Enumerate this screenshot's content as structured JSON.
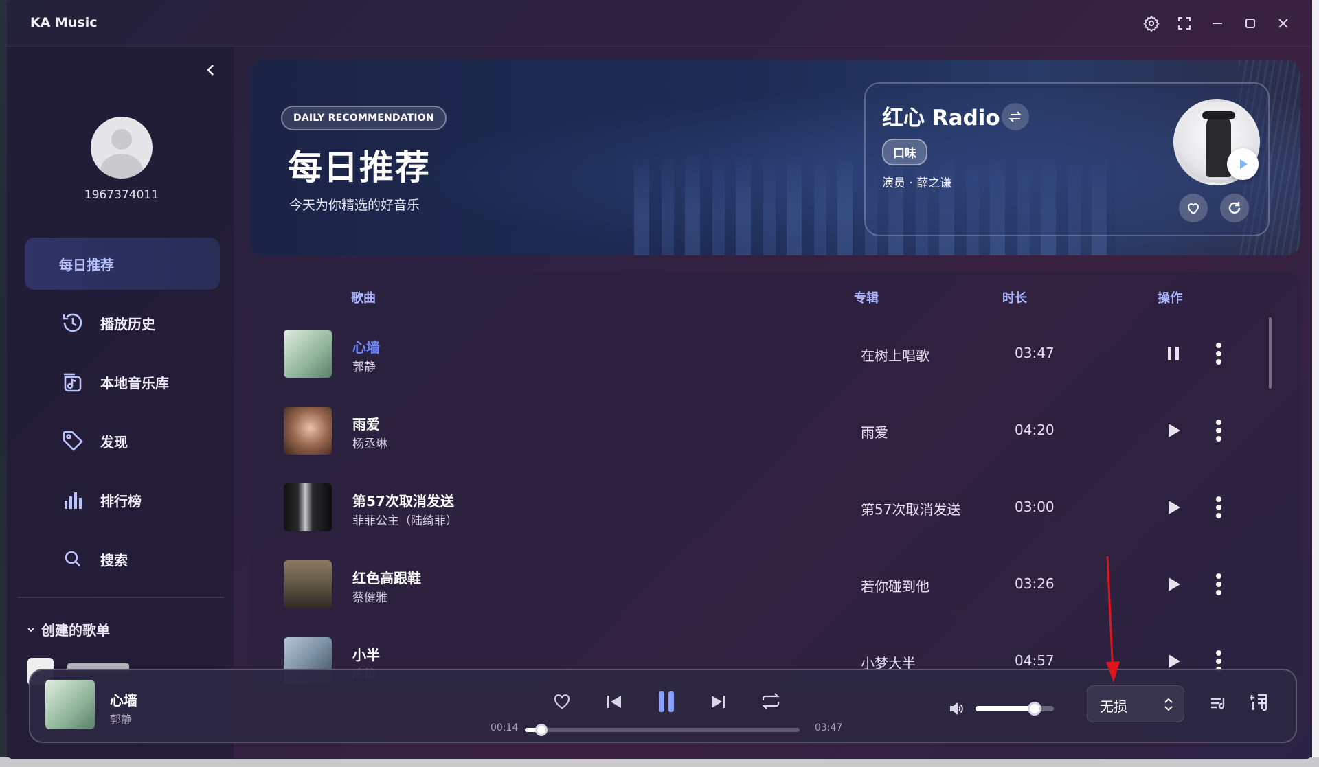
{
  "app": {
    "title": "KA Music"
  },
  "window_controls": [
    "gear-icon",
    "fullscreen-icon",
    "minimize-icon",
    "maximize-icon",
    "close-icon"
  ],
  "user": {
    "name": "1967374011"
  },
  "sidebar": {
    "items": [
      {
        "label": "每日推荐",
        "icon": "none",
        "active": true
      },
      {
        "label": "播放历史",
        "icon": "history-icon"
      },
      {
        "label": "本地音乐库",
        "icon": "local-library-icon"
      },
      {
        "label": "发现",
        "icon": "tag-icon"
      },
      {
        "label": "排行榜",
        "icon": "chart-bars-icon"
      },
      {
        "label": "搜索",
        "icon": "search-icon"
      }
    ],
    "created_playlists_label": "创建的歌单"
  },
  "banner": {
    "tag": "DAILY RECOMMENDATION",
    "title": "每日推荐",
    "subtitle": "今天为你精选的好音乐",
    "radio": {
      "title": "红心 Radio",
      "chip": "口味",
      "artist": "演员 · 薛之谦"
    }
  },
  "list": {
    "headers": {
      "song": "歌曲",
      "album": "专辑",
      "duration": "时长",
      "actions": "操作"
    },
    "rows": [
      {
        "title": "心墙",
        "artist": "郭静",
        "album": "在树上唱歌",
        "duration": "03:47",
        "playing": true,
        "cover_color": "#8fb59a"
      },
      {
        "title": "雨爱",
        "artist": "杨丞琳",
        "album": "雨爱",
        "duration": "04:20",
        "playing": false,
        "cover_color": "#9c6b52"
      },
      {
        "title": "第57次取消发送",
        "artist": "菲菲公主（陆绮菲）",
        "album": "第57次取消发送",
        "duration": "03:00",
        "playing": false,
        "cover_color": "#1c1c1e"
      },
      {
        "title": "红色高跟鞋",
        "artist": "蔡健雅",
        "album": "若你碰到他",
        "duration": "03:26",
        "playing": false,
        "cover_color": "#6b5e4a"
      },
      {
        "title": "小半",
        "artist": "陈粒",
        "album": "小梦大半",
        "duration": "04:57",
        "playing": false,
        "cover_color": "#7b8fa3"
      }
    ]
  },
  "player": {
    "title": "心墙",
    "artist": "郭静",
    "current_time": "00:14",
    "total_time": "03:47",
    "progress_fraction": 0.06,
    "volume_fraction": 0.75,
    "quality": "无损"
  },
  "colors": {
    "accent": "#6f87ff",
    "annotation_arrow": "#e0141c"
  }
}
